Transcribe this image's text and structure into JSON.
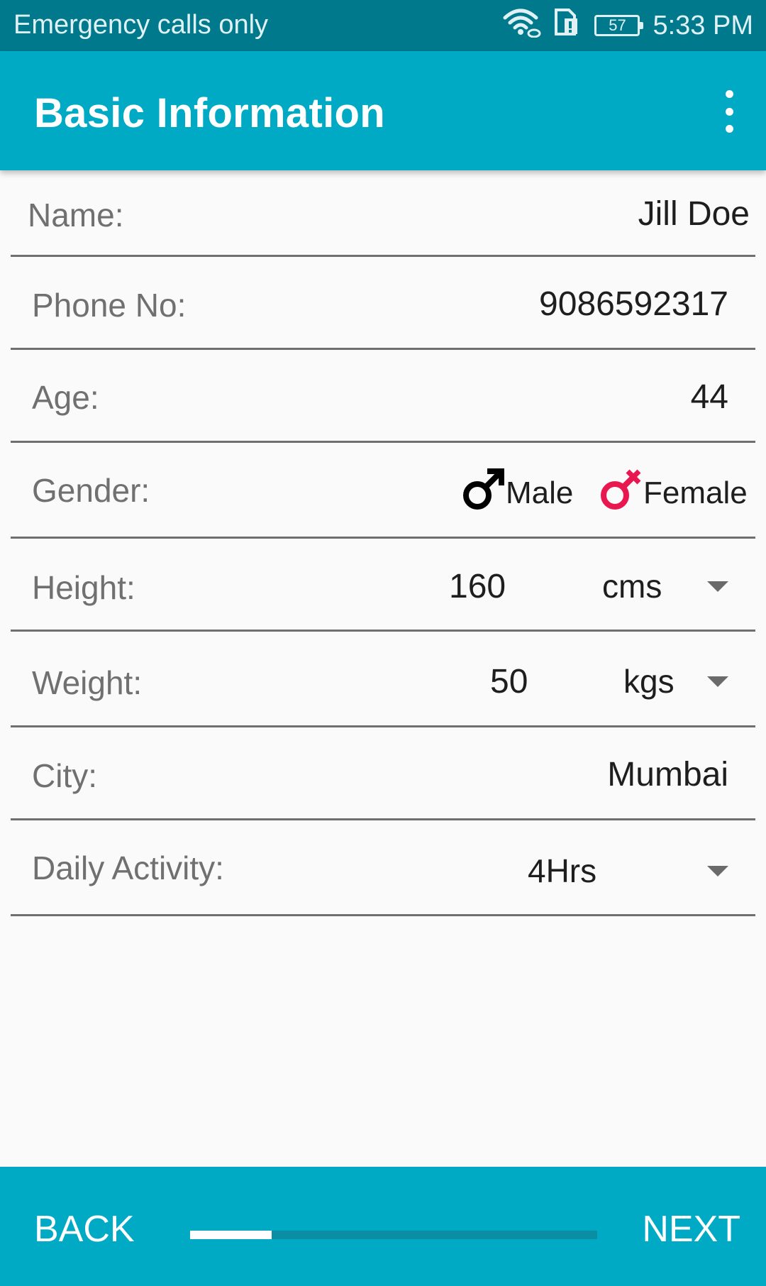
{
  "status_bar": {
    "carrier": "Emergency calls only",
    "battery": "57",
    "time": "5:33 PM",
    "icons": [
      "wifi-icon",
      "sim-icon",
      "battery-icon"
    ]
  },
  "app_bar": {
    "title": "Basic Information",
    "menu_icon": "overflow-menu-icon"
  },
  "form": {
    "name": {
      "label": "Name:",
      "value": "Jill Doe"
    },
    "phone": {
      "label": "Phone No:",
      "value": "9086592317"
    },
    "age": {
      "label": "Age:",
      "value": "44"
    },
    "gender": {
      "label": "Gender:",
      "options": [
        {
          "label": "Male",
          "icon": "male-symbol-icon",
          "color": "#000000"
        },
        {
          "label": "Female",
          "icon": "female-symbol-icon",
          "color": "#e8174f"
        }
      ]
    },
    "height": {
      "label": "Height:",
      "value": "160",
      "unit": "cms"
    },
    "weight": {
      "label": "Weight:",
      "value": "50",
      "unit": "kgs"
    },
    "city": {
      "label": "City:",
      "value": "Mumbai"
    },
    "daily_activity": {
      "label": "Daily Activity:",
      "value": "4Hrs"
    }
  },
  "bottom_bar": {
    "back_label": "BACK",
    "next_label": "NEXT",
    "progress_fraction": 0.2
  },
  "colors": {
    "primary": "#00aac4",
    "status_bar": "#00798c",
    "female_accent": "#e8174f"
  }
}
